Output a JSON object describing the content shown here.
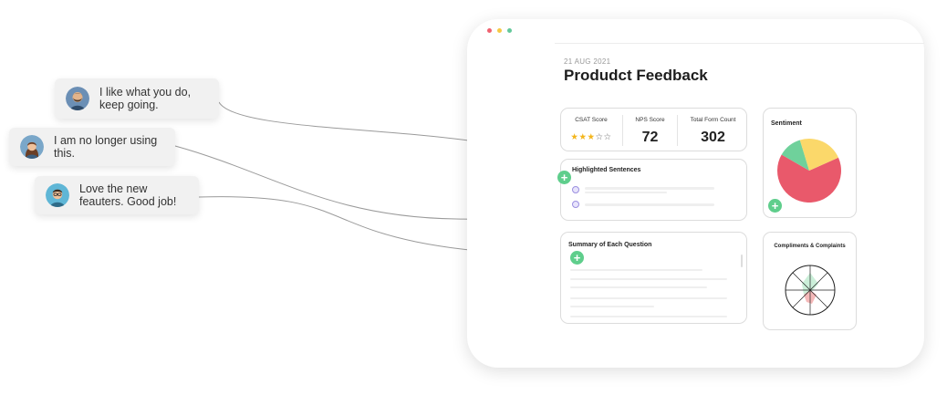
{
  "colors": {
    "accent_green": "#5fce8c",
    "dot_red": "#f0616f",
    "dot_yellow": "#f6c945",
    "dot_green": "#63c89a",
    "star": "#f3b51b"
  },
  "bubbles": [
    {
      "text": "I like what you do, keep going.",
      "avatar": "man-with-beard-avatar"
    },
    {
      "text": "I am no longer using this.",
      "avatar": "woman-avatar"
    },
    {
      "text": "Love the new feauters. Good job!",
      "avatar": "man-with-glasses-avatar"
    }
  ],
  "dashboard": {
    "date": "21 AUG 2021",
    "title": "Produdct Feedback",
    "scores": {
      "csat_label": "CSAT Score",
      "csat_stars": 3,
      "csat_max": 5,
      "nps_label": "NPS Score",
      "nps_value": "72",
      "total_label": "Total Form Count",
      "total_value": "302"
    },
    "highlighted_title": "Highlighted Sentences",
    "summary_title": "Summary of Each Question",
    "sentiment_title": "Sentiment",
    "compliments_title": "Compliments & Complaints"
  },
  "chart_data": {
    "type": "pie",
    "values": [
      65,
      12,
      23
    ],
    "colors": [
      "#e9596b",
      "#6fd19b",
      "#fbd86a"
    ]
  },
  "icons": {
    "plus": "+"
  }
}
